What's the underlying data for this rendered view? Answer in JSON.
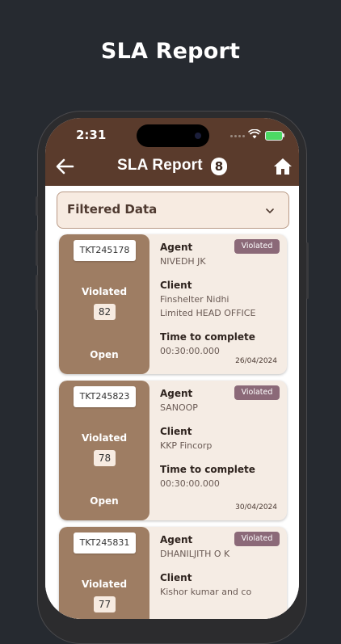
{
  "promo_title": "SLA Report",
  "status_bar": {
    "time": "2:31"
  },
  "header": {
    "title": "SLA Report",
    "count": "8"
  },
  "filter": {
    "label": "Filtered Data"
  },
  "labels": {
    "agent": "Agent",
    "client": "Client",
    "time_to_complete": "Time to complete"
  },
  "tickets": [
    {
      "id": "TKT245178",
      "status": "Violated",
      "score": "82",
      "state": "Open",
      "tag": "Violated",
      "agent": "NIVEDH JK",
      "client_line1": "Finshelter Nidhi",
      "client_line2": "Limited HEAD OFFICE",
      "time": "00:30:00.000",
      "date": "26/04/2024"
    },
    {
      "id": "TKT245823",
      "status": "Violated",
      "score": "78",
      "state": "Open",
      "tag": "Violated",
      "agent": "SANOOP",
      "client_line1": "KKP Fincorp",
      "client_line2": "",
      "time": "00:30:00.000",
      "date": "30/04/2024"
    },
    {
      "id": "TKT245831",
      "status": "Violated",
      "score": "77",
      "state": "",
      "tag": "Violated",
      "agent": "DHANILJITH O K",
      "client_line1": "Kishor kumar and co",
      "client_line2": "",
      "time": "",
      "date": ""
    }
  ],
  "colors": {
    "background": "#262a30",
    "header": "#5a3b2c",
    "card_left": "#9e7d63",
    "card_bg": "#f5ece4",
    "violated_tag": "#8b6978"
  }
}
